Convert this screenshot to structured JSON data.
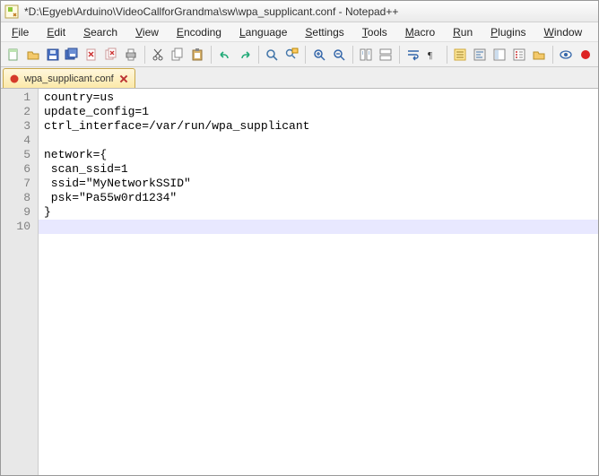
{
  "window": {
    "title": "*D:\\Egyeb\\Arduino\\VideoCallforGrandma\\sw\\wpa_supplicant.conf - Notepad++"
  },
  "menu": {
    "items": [
      {
        "hotkey": "F",
        "rest": "ile"
      },
      {
        "hotkey": "E",
        "rest": "dit"
      },
      {
        "hotkey": "S",
        "rest": "earch"
      },
      {
        "hotkey": "V",
        "rest": "iew"
      },
      {
        "hotkey": "E",
        "rest": "ncoding",
        "pre": ""
      },
      {
        "hotkey": "L",
        "rest": "anguage"
      },
      {
        "hotkey": "S",
        "rest": "ettings",
        "pre": ""
      },
      {
        "hotkey": "T",
        "rest": "ools"
      },
      {
        "hotkey": "M",
        "rest": "acro"
      },
      {
        "hotkey": "R",
        "rest": "un"
      },
      {
        "hotkey": "P",
        "rest": "lugins"
      },
      {
        "hotkey": "W",
        "rest": "indow"
      },
      {
        "hotkey": "?",
        "rest": ""
      }
    ]
  },
  "toolbar": {
    "icons": [
      "new-file-icon",
      "open-file-icon",
      "save-icon",
      "save-all-icon",
      "close-icon",
      "close-all-icon",
      "print-icon",
      "sep",
      "cut-icon",
      "copy-icon",
      "paste-icon",
      "sep",
      "undo-icon",
      "redo-icon",
      "sep",
      "find-icon",
      "replace-icon",
      "sep",
      "zoom-in-icon",
      "zoom-out-icon",
      "sep",
      "sync-v-icon",
      "sync-h-icon",
      "sep",
      "wordwrap-icon",
      "all-chars-icon",
      "sep",
      "indent-guide-icon",
      "lang-udl-icon",
      "doc-map-icon",
      "func-list-icon",
      "folder-icon",
      "sep",
      "monitor-icon",
      "record-icon"
    ]
  },
  "tabs": {
    "active": {
      "label": "wpa_supplicant.conf",
      "dirty": true
    }
  },
  "editor": {
    "current_line": 10,
    "lines": [
      "country=us",
      "update_config=1",
      "ctrl_interface=/var/run/wpa_supplicant",
      "",
      "network={",
      " scan_ssid=1",
      " ssid=\"MyNetworkSSID\"",
      " psk=\"Pa55w0rd1234\"",
      "}",
      ""
    ]
  }
}
